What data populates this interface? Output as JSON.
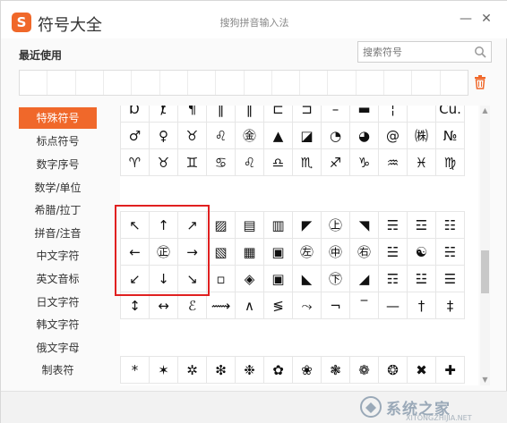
{
  "titlebar": {
    "logo_glyph": "S",
    "app_title": "符号大全",
    "ime_title": "搜狗拼音输入法",
    "minimize": "—",
    "close": "✕"
  },
  "recent": {
    "label": "最近使用",
    "search_placeholder": "搜索符号"
  },
  "sidebar": {
    "items": [
      {
        "label": "特殊符号",
        "active": true
      },
      {
        "label": "标点符号"
      },
      {
        "label": "数字序号"
      },
      {
        "label": "数学/单位"
      },
      {
        "label": "希腊/拉丁"
      },
      {
        "label": "拼音/注音"
      },
      {
        "label": "中文字符"
      },
      {
        "label": "英文音标"
      },
      {
        "label": "日文字符"
      },
      {
        "label": "韩文字符"
      },
      {
        "label": "俄文字母"
      },
      {
        "label": "制表符"
      }
    ]
  },
  "symbols": {
    "block1_rows": [
      [
        "Ɒ",
        "ⱦ",
        "¶",
        "‖",
        "‖",
        "⊏",
        "⊐",
        "–",
        "▬",
        "¦",
        "Cu."
      ],
      [
        "♂",
        "♀",
        "♉",
        "♌",
        "㊎",
        "▲",
        "◪",
        "◔",
        "◕",
        "@",
        "㈱",
        "№"
      ],
      [
        "♈",
        "♉",
        "♊",
        "♋",
        "♌",
        "♎",
        "♏",
        "♐",
        "♑",
        "♒",
        "♓",
        "♍"
      ]
    ],
    "block2_rows": [
      [
        "↖",
        "↑",
        "↗",
        "▨",
        "▤",
        "▥",
        "◤",
        "㊤",
        "◥",
        "☴",
        "☲",
        "☷"
      ],
      [
        "←",
        "㊣",
        "→",
        "▧",
        "▦",
        "▣",
        "㊧",
        "㊥",
        "㊨",
        "☱",
        "☯",
        "☵"
      ],
      [
        "↙",
        "↓",
        "↘",
        "▫",
        "◈",
        "▣",
        "◣",
        "㊦",
        "◢",
        "☶",
        "☳",
        "☰"
      ],
      [
        "↕",
        "↔",
        "ℰ",
        "⟿",
        "∧",
        "≶",
        "⤳",
        "¬",
        "‾",
        "—",
        "†",
        "‡"
      ]
    ],
    "block3_rows": [
      [
        "*",
        "✶",
        "✲",
        "❇",
        "❉",
        "✿",
        "❀",
        "❃",
        "❁",
        "❂",
        "✖",
        "✚"
      ]
    ]
  },
  "watermark": {
    "text": "系统之家",
    "sub": "XITONGZHIJIA.NET"
  },
  "colors": {
    "accent": "#f0682a",
    "highlight": "#e02020"
  }
}
